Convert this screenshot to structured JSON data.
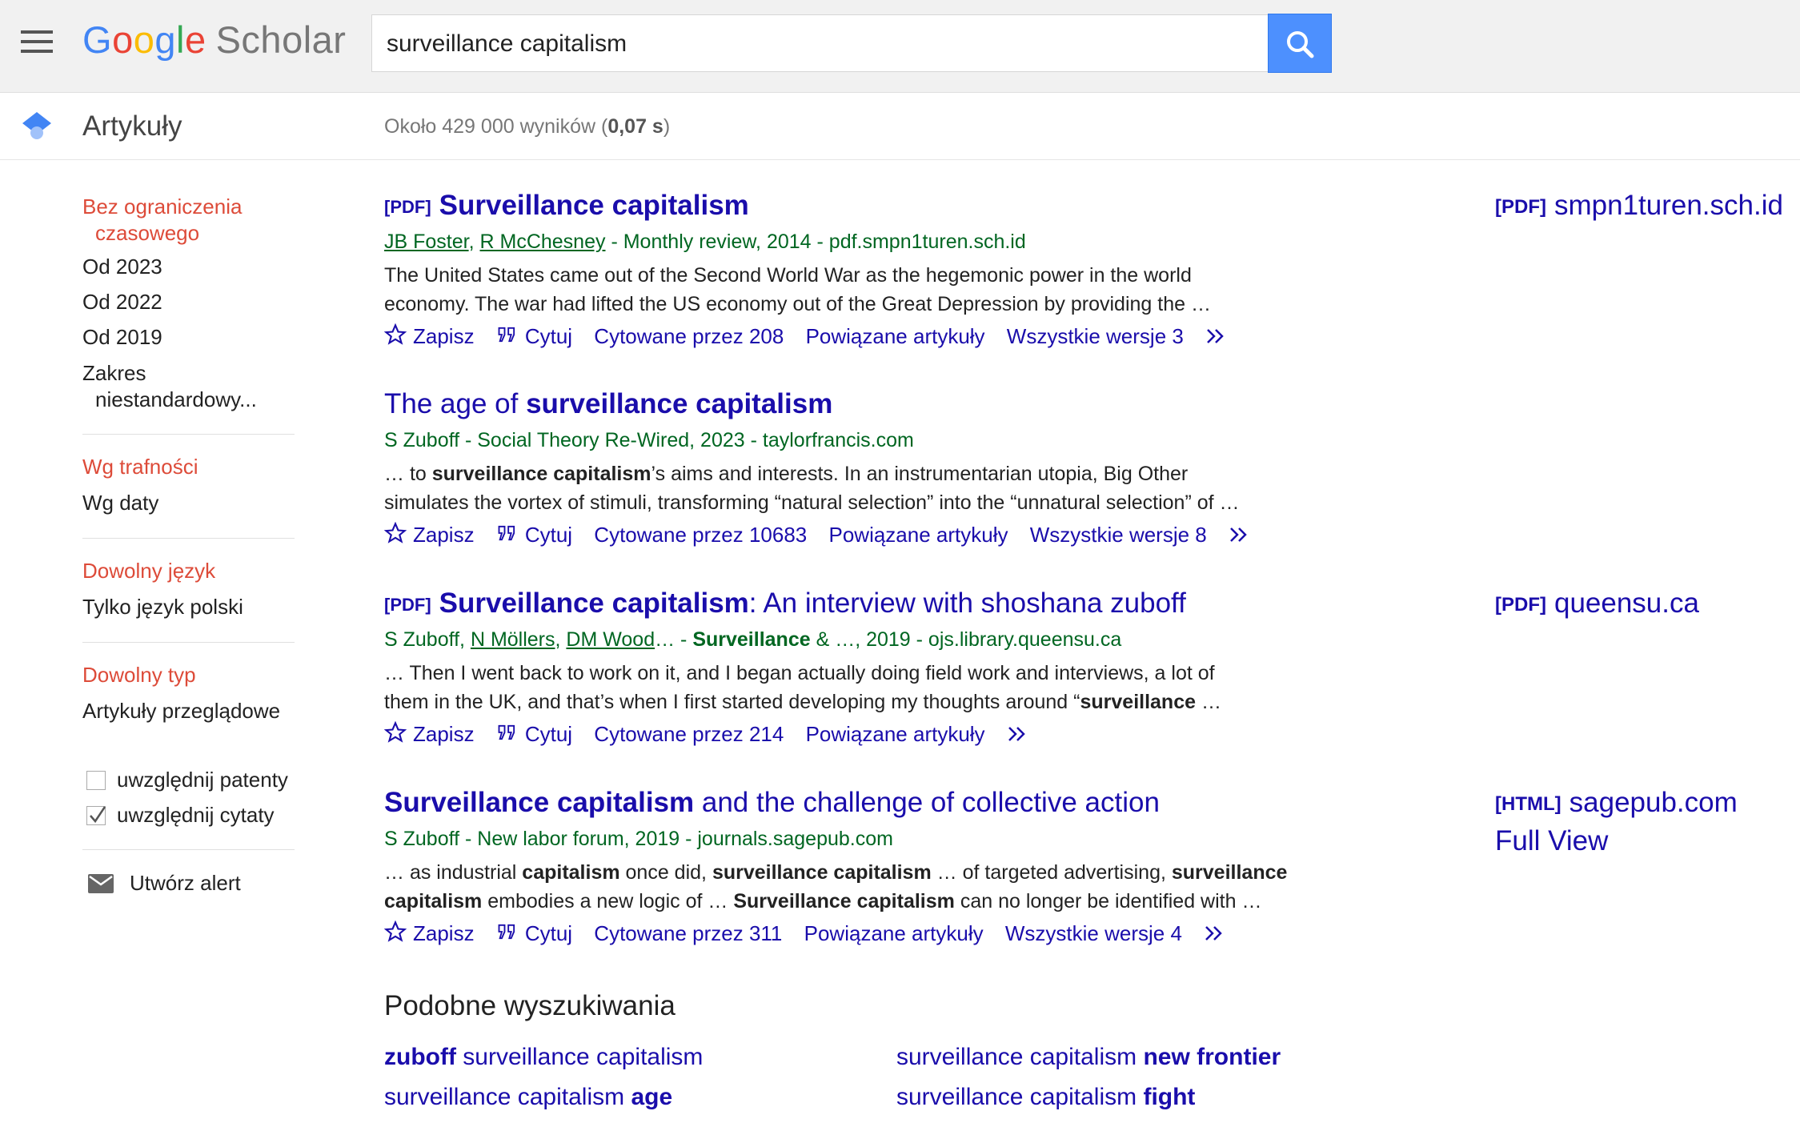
{
  "header": {
    "logo_google": [
      "G",
      "o",
      "o",
      "g",
      "l",
      "e"
    ],
    "logo_scholar": "Scholar",
    "search_value": "surveillance capitalism"
  },
  "subheader": {
    "section": "Artykuły",
    "count_prefix": "Około 429 000 wyników (",
    "count_time": "0,07 s",
    "count_suffix": ")"
  },
  "sidebar": {
    "time_any": "Bez ograniczenia",
    "time_any_2": "czasowego",
    "time_2023": "Od 2023",
    "time_2022": "Od 2022",
    "time_2019": "Od 2019",
    "time_custom": "Zakres",
    "time_custom_2": "niestandardowy...",
    "sort_relevance": "Wg trafności",
    "sort_date": "Wg daty",
    "lang_any": "Dowolny język",
    "lang_pl": "Tylko język polski",
    "type_any": "Dowolny typ",
    "type_review": "Artykuły przeglądowe",
    "include_patents": "uwzględnij patenty",
    "include_citations": "uwzględnij cytaty",
    "create_alert": "Utwórz alert"
  },
  "actions": {
    "save": "Zapisz",
    "cite": "Cytuj",
    "related": "Powiązane artykuły"
  },
  "results": [
    {
      "tag": "[PDF]",
      "title_bold": "Surveillance capitalism",
      "author1": "JB Foster",
      "sep": ", ",
      "author2": "R McChesney",
      "meta_rest": " - Monthly review, 2014 - pdf.smpn1turen.sch.id",
      "snip1": "The United States came out of the Second World War as the hegemonic power in the world",
      "snip2": "economy. The war had lifted the US economy out of the Great Depression by providing the …",
      "cited": "Cytowane przez 208",
      "versions": "Wszystkie wersje 3",
      "side_tag": "[PDF]",
      "side_domain": "smpn1turen.sch.id"
    },
    {
      "title_pre": "The age of ",
      "title_bold": "surveillance capitalism",
      "meta": "S Zuboff - Social Theory Re-Wired, 2023 - taylorfrancis.com",
      "snip1_a": "… to ",
      "snip1_b": "surveillance capitalism",
      "snip1_c": "’s aims and interests. In an instrumentarian utopia, Big Other",
      "snip2": "simulates the vortex of stimuli, transforming “natural selection” into the “unnatural selection” of …",
      "cited": "Cytowane przez 10683",
      "versions": "Wszystkie wersje 8"
    },
    {
      "tag": "[PDF]",
      "title_bold": "Surveillance capitalism",
      "title_rest": ": An interview with shoshana zuboff",
      "meta_a": "S Zuboff, ",
      "author2": "N Möllers",
      "sep": ", ",
      "author3": "DM Wood",
      "meta_b": "… - ",
      "meta_bold": "Surveillance",
      "meta_c": " & …, 2019 - ojs.library.queensu.ca",
      "snip1": "… Then I went back to work on it, and I began actually doing field work and interviews, a lot of",
      "snip2_a": "them in the UK, and that’s when I first started developing my thoughts around “",
      "snip2_b": "surveillance",
      "snip2_c": " …",
      "cited": "Cytowane przez 214",
      "side_tag": "[PDF]",
      "side_domain": "queensu.ca"
    },
    {
      "title_bold": "Surveillance capitalism",
      "title_rest": " and the challenge of collective action",
      "meta": "S Zuboff - New labor forum, 2019 - journals.sagepub.com",
      "s1": "… as industrial ",
      "s1b": "capitalism",
      "s2": " once did, ",
      "s2b": "surveillance capitalism",
      "s3": " … of targeted advertising, ",
      "s3b": "surveillance",
      "s4b": "capitalism",
      "s4": " embodies a new logic of … ",
      "s5b": "Surveillance capitalism",
      "s5": " can no longer be identified with …",
      "cited": "Cytowane przez 311",
      "versions": "Wszystkie wersje 4",
      "side_tag": "[HTML]",
      "side_domain": "sagepub.com",
      "side_full": "Full View"
    }
  ],
  "related": {
    "title": "Podobne wyszukiwania",
    "r1_bold": "zuboff",
    "r1_rest": " surveillance capitalism",
    "r2_rest": "surveillance capitalism ",
    "r2_bold": "new frontier",
    "r3_rest": "surveillance capitalism ",
    "r3_bold": "age",
    "r4_rest": "surveillance capitalism ",
    "r4_bold": "fight"
  },
  "colors": {
    "link": "#1a0dab",
    "meta_green": "#006621",
    "sidebar_red": "#dd4b39",
    "search_button": "#4d90fe"
  }
}
